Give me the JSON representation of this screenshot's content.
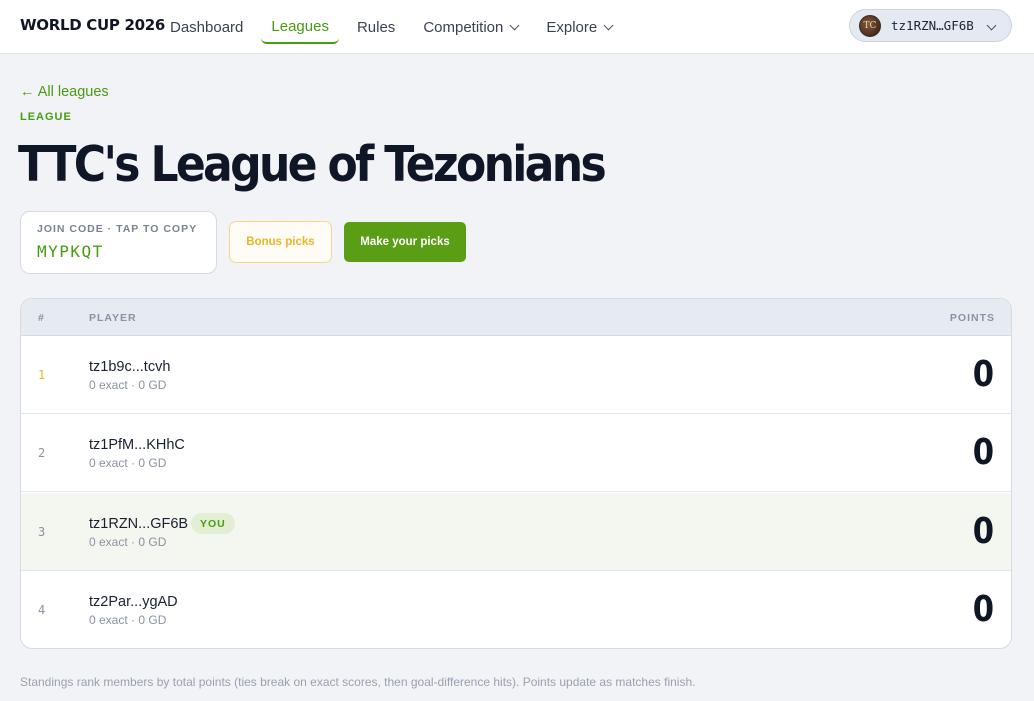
{
  "brand": "WORLD CUP 2026",
  "nav": {
    "dashboard": "Dashboard",
    "leagues": "Leagues",
    "rules": "Rules",
    "competition": "Competition",
    "explore": "Explore"
  },
  "wallet": {
    "address": "tz1RZN…GF6B",
    "avatar_text": "TC"
  },
  "back_link": "← All leagues",
  "eyebrow": "LEAGUE",
  "title": "TTC's League of Tezonians",
  "join": {
    "label": "JOIN CODE · TAP TO COPY",
    "code": "MYPKQT"
  },
  "buttons": {
    "bonus": "Bonus picks",
    "picks": "Make your picks"
  },
  "table": {
    "headers": {
      "rank": "#",
      "player": "PLAYER",
      "points": "POINTS"
    },
    "rows": [
      {
        "rank": "1",
        "name": "tz1b9c...tcvh",
        "sub": "0 exact · 0 GD",
        "points": "0"
      },
      {
        "rank": "2",
        "name": "tz1PfM...KHhC",
        "sub": "0 exact · 0 GD",
        "points": "0"
      },
      {
        "rank": "3",
        "name": "tz1RZN...GF6B",
        "sub": "0 exact · 0 GD",
        "points": "0",
        "badge": "YOU"
      },
      {
        "rank": "4",
        "name": "tz2Par...ygAD",
        "sub": "0 exact · 0 GD",
        "points": "0"
      }
    ]
  },
  "footnote": "Standings rank members by total points (ties break on exact scores, then goal-difference hits). Points update as matches finish.",
  "colors": {
    "accent": "#4a9a12",
    "gold": "#e8b72b",
    "ink": "#0f1626",
    "background": "#f1f3f7"
  }
}
